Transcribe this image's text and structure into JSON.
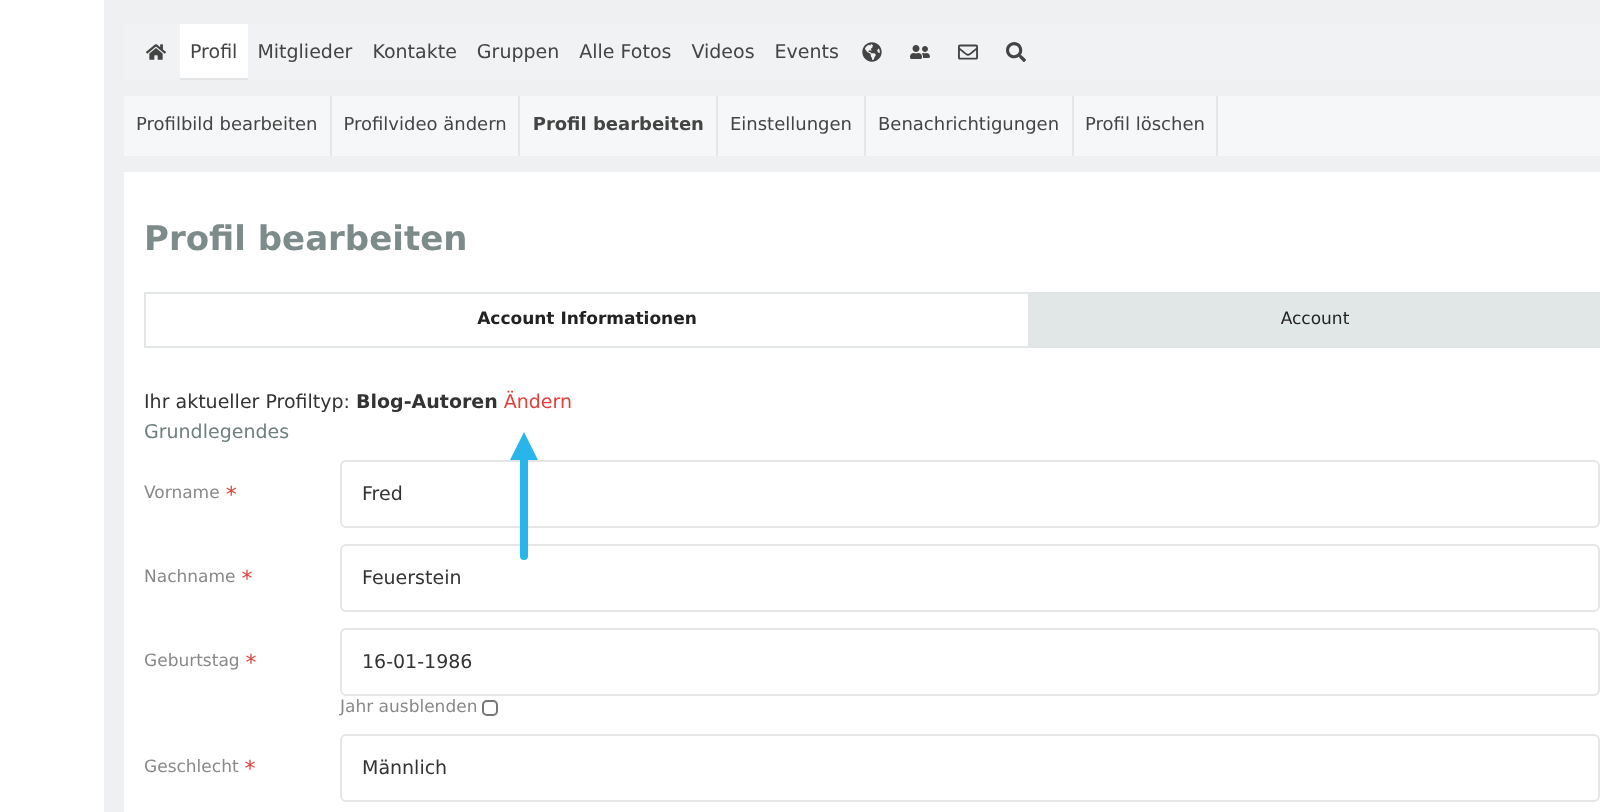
{
  "nav": {
    "items": [
      {
        "kind": "home"
      },
      {
        "kind": "text",
        "label": "Profil",
        "selected": true
      },
      {
        "kind": "text",
        "label": "Mitglieder",
        "selected": false
      },
      {
        "kind": "text",
        "label": "Kontakte",
        "selected": false
      },
      {
        "kind": "text",
        "label": "Gruppen",
        "selected": false
      },
      {
        "kind": "text",
        "label": "Alle Fotos",
        "selected": false
      },
      {
        "kind": "text",
        "label": "Videos",
        "selected": false
      },
      {
        "kind": "text",
        "label": "Events",
        "selected": false
      },
      {
        "kind": "globe"
      },
      {
        "kind": "people"
      },
      {
        "kind": "mail"
      },
      {
        "kind": "search"
      }
    ]
  },
  "subnav": [
    {
      "label": "Profilbild bearbeiten",
      "selected": false
    },
    {
      "label": "Profilvideo ändern",
      "selected": false
    },
    {
      "label": "Profil bearbeiten",
      "selected": true
    },
    {
      "label": "Einstellungen",
      "selected": false
    },
    {
      "label": "Benachrichtigungen",
      "selected": false
    },
    {
      "label": "Profil löschen",
      "selected": false
    }
  ],
  "page_title": "Profil bearbeiten",
  "tabs": [
    {
      "label": "Account Informationen",
      "selected": true
    },
    {
      "label": "Account",
      "selected": false
    }
  ],
  "profile_type": {
    "text": "Ihr aktueller Profiltyp: **Blog-Autoren**",
    "link": "Ändern"
  },
  "section": "Grundlegendes",
  "fields": [
    {
      "label": "Vorname",
      "required": "*",
      "value": "Fred"
    },
    {
      "label": "Nachname",
      "required": "*",
      "value": "Feuerstein"
    },
    {
      "label": "Geburtstag",
      "required": "*",
      "value": "16-01-1986",
      "option": {
        "label": "Jahr ausblenden",
        "checked": false
      }
    },
    {
      "label": "Geschlecht",
      "required": "*",
      "value": "Männlich"
    }
  ]
}
